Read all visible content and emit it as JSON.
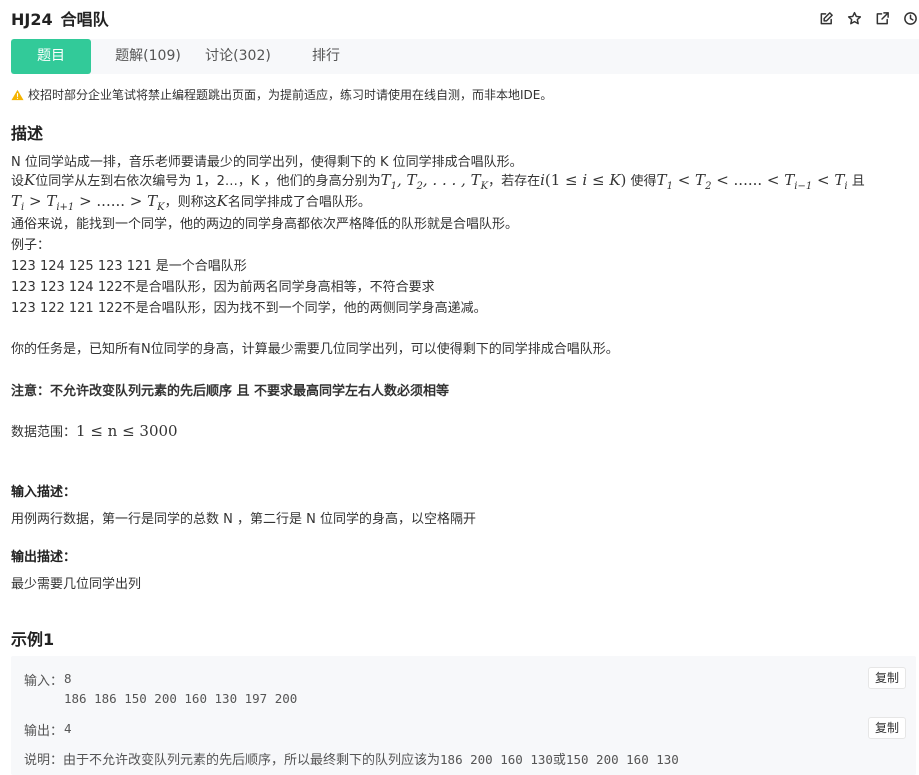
{
  "header": {
    "problem_id": "HJ24",
    "problem_title": "合唱队",
    "icons": [
      "edit-icon",
      "star-icon",
      "external-link-icon",
      "clock-icon"
    ]
  },
  "tabs": [
    {
      "label": "题目",
      "active": true
    },
    {
      "label": "题解(109)",
      "active": false
    },
    {
      "label": "讨论(302)",
      "active": false
    },
    {
      "label": "排行",
      "active": false
    }
  ],
  "notice": "校招时部分企业笔试将禁止编程题跳出页面，为提前适应，练习时请使用在线自测，而非本地IDE。",
  "description": {
    "heading": "描述",
    "line1": "N 位同学站成一排，音乐老师要请最少的同学出列，使得剩下的 K 位同学排成合唱队形。",
    "line2_a": "设",
    "line2_b": "位同学从左到右依次编号为 1，2…，K ，他们的身高分别为",
    "line2_c": "，若存在",
    "line2_d": "使得",
    "line2_e": "且",
    "line3_b": "，则称这",
    "line3_c": "名同学排成了合唱队形。",
    "line4": "通俗来说，能找到一个同学，他的两边的同学身高都依次严格降低的队形就是合唱队形。",
    "line5": "例子：",
    "line6": "123 124 125 123 121 是一个合唱队形",
    "line7": "123 123 124 122不是合唱队形，因为前两名同学身高相等，不符合要求",
    "line8": "123 122 121 122不是合唱队形，因为找不到一个同学，他的两侧同学身高递减。",
    "task": "你的任务是，已知所有N位同学的身高，计算最少需要几位同学出列，可以使得剩下的同学排成合唱队形。",
    "note": "注意：不允许改变队列元素的先后顺序 且 不要求最高同学左右人数必须相等",
    "range_label": "数据范围：",
    "range_expr": "1 ≤ n ≤ 3000"
  },
  "input_desc": {
    "heading": "输入描述：",
    "text": "用例两行数据，第一行是同学的总数 N ，第二行是 N 位同学的身高，以空格隔开"
  },
  "output_desc": {
    "heading": "输出描述：",
    "text": "最少需要几位同学出列"
  },
  "example": {
    "heading": "示例1",
    "input_label": "输入：",
    "input_line1": "8",
    "input_line2": "186 186 150 200 160 130 197 200",
    "output_label": "输出：",
    "output_value": "4",
    "copy_label": "复制",
    "explain_label": "说明：",
    "explain_a": "由于不允许改变队列元素的先后顺序，所以最终剩下的队列应该为",
    "explain_seq1": "186 200 160 130",
    "explain_or": "或",
    "explain_seq2": "150 200 160 130"
  }
}
